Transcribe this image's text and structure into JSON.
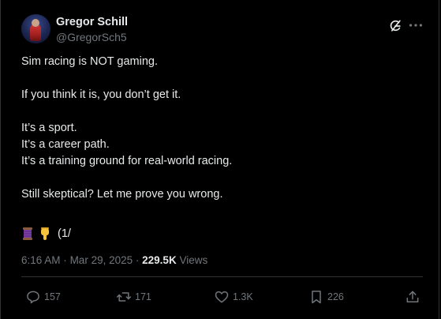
{
  "author": {
    "display_name": "Gregor Schill",
    "handle": "@GregorSch5"
  },
  "tweet": {
    "lines": [
      "Sim racing is NOT gaming.",
      "",
      "If you think it is, you don’t get it.",
      "",
      "It’s a sport.",
      "It’s a career path.",
      "It’s a training ground for real-world racing.",
      "",
      "Still skeptical? Let me prove you wrong."
    ],
    "thread_marker": "(1/"
  },
  "meta": {
    "time": "6:16 AM",
    "separator": "·",
    "date": "Mar 29, 2025",
    "views_count": "229.5K",
    "views_label": "Views"
  },
  "actions": {
    "replies": "157",
    "reposts": "171",
    "likes": "1.3K",
    "bookmarks": "226"
  },
  "icons": {
    "grok": "grok-icon",
    "more": "more-icon",
    "reply": "reply-icon",
    "repost": "repost-icon",
    "like": "heart-icon",
    "bookmark": "bookmark-icon",
    "share": "share-icon",
    "thread": "thread-emoji",
    "point_down": "point-down-emoji"
  },
  "colors": {
    "background": "#000000",
    "text": "#e7e9ea",
    "secondary": "#71767b",
    "border": "#2f3336"
  }
}
